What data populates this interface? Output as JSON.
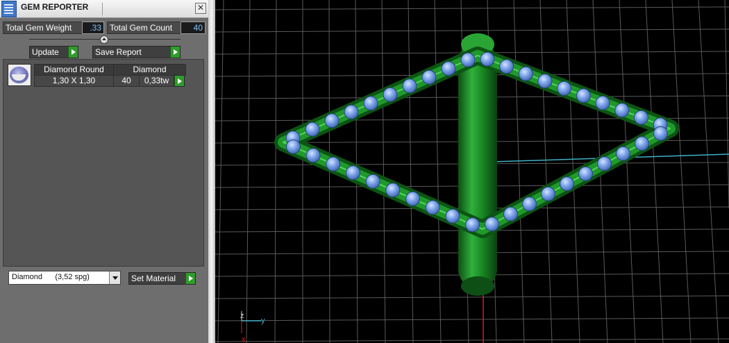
{
  "panel": {
    "title": "GEM REPORTER",
    "close_label": "✕",
    "total_weight_label": "Total Gem Weight",
    "total_weight_value": ".33",
    "total_count_label": "Total Gem Count",
    "total_count_value": "40",
    "update_label": "Update",
    "save_report_label": "Save Report",
    "table": {
      "headers": [
        "Diamond Round",
        "Diamond"
      ],
      "row": {
        "size": "1,30 X 1,30",
        "count": "40",
        "weight": "0,33tw"
      }
    },
    "material_select": "Diamond      (3,52 spg)",
    "set_material_label": "Set Material"
  },
  "viewport": {
    "axis_labels": {
      "z": "z",
      "y": "y",
      "x": "x"
    },
    "colors": {
      "background": "#000000",
      "grid": "#5a5a5a",
      "ring_green": "#1f9a2a",
      "gem_blue": "#7ea6ea",
      "axis_cyan": "#3fb0c8",
      "axis_red": "#d12020"
    }
  }
}
